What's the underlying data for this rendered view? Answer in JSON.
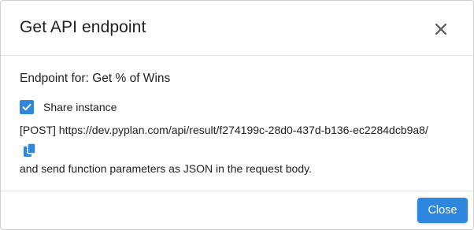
{
  "dialog": {
    "title": "Get API endpoint",
    "close_icon": "close-icon"
  },
  "content": {
    "endpoint_text": "Endpoint for: Get % of Wins",
    "share_instance": {
      "label": "Share instance",
      "checked": true
    },
    "url_text": "[POST] https://dev.pyplan.com/api/result/f274199c-28d0-437d-b136-ec2284dcb9a8/",
    "copy_icon": "copy-icon",
    "hint_text": "and send function parameters as JSON in the request body."
  },
  "footer": {
    "close_label": "Close"
  },
  "colors": {
    "accent": "#2e86de",
    "text": "#212121",
    "divider": "#e3e3e3"
  }
}
